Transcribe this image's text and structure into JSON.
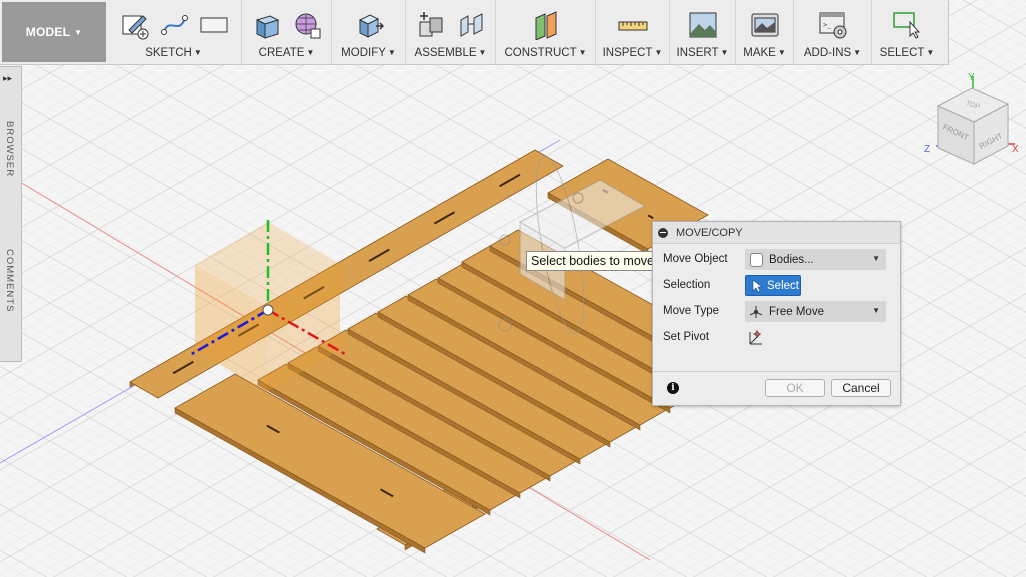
{
  "toolbar": {
    "model_label": "MODEL",
    "groups": [
      {
        "label": "SKETCH",
        "icons": [
          "create-sketch-icon",
          "spline-icon",
          "rectangle-icon"
        ]
      },
      {
        "label": "CREATE",
        "icons": [
          "box-icon",
          "form-icon"
        ]
      },
      {
        "label": "MODIFY",
        "icons": [
          "press-pull-icon"
        ]
      },
      {
        "label": "ASSEMBLE",
        "icons": [
          "new-component-icon",
          "joint-icon"
        ]
      },
      {
        "label": "CONSTRUCT",
        "icons": [
          "offset-plane-icon"
        ]
      },
      {
        "label": "INSPECT",
        "icons": [
          "measure-icon"
        ]
      },
      {
        "label": "INSERT",
        "icons": [
          "insert-image-icon"
        ]
      },
      {
        "label": "MAKE",
        "icons": [
          "3d-print-icon"
        ]
      },
      {
        "label": "ADD-INS",
        "icons": [
          "scripts-icon"
        ]
      },
      {
        "label": "SELECT",
        "icons": [
          "select-window-icon"
        ]
      }
    ]
  },
  "sidepanel": {
    "expand_glyph": "▸▸",
    "browser_label": "BROWSER",
    "comments_label": "COMMENTS"
  },
  "viewcube": {
    "top": "TOP",
    "front": "FRONT",
    "right": "RIGHT",
    "axis_y": "Y",
    "axis_z": "Z",
    "axis_x": "X"
  },
  "dialog": {
    "title": "MOVE/COPY",
    "rows": {
      "move_object": {
        "label": "Move Object",
        "value": "Bodies..."
      },
      "selection": {
        "label": "Selection",
        "value": "Select"
      },
      "move_type": {
        "label": "Move Type",
        "value": "Free Move"
      },
      "set_pivot": {
        "label": "Set Pivot"
      }
    },
    "ok_label": "OK",
    "cancel_label": "Cancel"
  },
  "tooltip": "Select bodies to move",
  "colors": {
    "wood": "#d9a04f",
    "wood_dark": "#8a5a1e",
    "accent_blue": "#2f7ad1",
    "axis_green": "#1fbf2a",
    "axis_red": "#e01818",
    "axis_blue": "#1a1ae0"
  }
}
